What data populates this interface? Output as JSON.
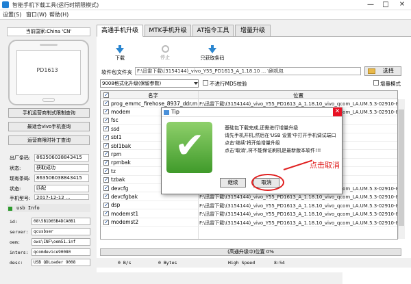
{
  "window": {
    "title": "智能手机下载工具(运行时期限模式)",
    "min": "—",
    "max": "□",
    "close": "✕"
  },
  "menu": [
    "设置(S)",
    "窗口(W)",
    "帮助(H)"
  ],
  "left": {
    "country": "当前国家:China 'CN'",
    "phone_model": "PD1613",
    "buttons": [
      "手机运营商制式限制查询",
      "最适合vivo手机查询",
      "运营商限时补丁查询"
    ],
    "info": [
      {
        "label": "出厂条码:",
        "value": "863506038843415"
      },
      {
        "label": "状态:",
        "value": "获取成功"
      },
      {
        "label": "现有条码:",
        "value": "863506038843415"
      },
      {
        "label": "状态:",
        "value": "匹配"
      },
      {
        "label": "手机型号:",
        "value": "2017-12-12 ..."
      }
    ],
    "usb_title": "usb Info",
    "usb": [
      {
        "key": "id:",
        "value": "08\\5B1D65B4DCA0B1"
      },
      {
        "key": "server:",
        "value": "qcusbser"
      },
      {
        "key": "oem:",
        "value": "ows\\INF\\oem51.inf"
      },
      {
        "key": "inters:",
        "value": "qcomdevice90080"
      },
      {
        "key": "desc:",
        "value": "USB QDLoader 9008"
      }
    ]
  },
  "tabs": [
    "高通手机升级",
    "MTK手机升级",
    "AT指令工具",
    "增量升级"
  ],
  "toolbar": [
    {
      "label": "下载",
      "icon": "download-icon"
    },
    {
      "label": "停止",
      "icon": "stop-icon"
    },
    {
      "label": "只获取条码",
      "icon": "barcode-icon"
    }
  ],
  "firmware": {
    "label": "软件包文件夹",
    "path": "F:\\迅雷下载\\(3154144)_vivo_Y55_PD1613_A_1.18.10 ... \\刷机包",
    "select": "选择"
  },
  "mode": {
    "selected": "9008格式化升级(保留参数)",
    "no_md5": "不进行MD5校验",
    "incremental": "增量模式"
  },
  "table": {
    "headers": [
      "名字",
      "位置"
    ],
    "rows": [
      {
        "name": "prog_emmc_firehose_8937_ddr.mbn",
        "loc": "F:\\迅雷下载\\(3154144)_vivo_Y55_PD1613_A_1.18.10_vivo_qcom_LA.UM.5.3-02910-89..."
      },
      {
        "name": "modem",
        "loc": "F:\\迅雷下载\\(3154144)_vivo_Y55_PD1613_A_1.18.10_vivo_qcom_LA.UM.5.3-02910-89..."
      },
      {
        "name": "fsc",
        "loc": ""
      },
      {
        "name": "ssd",
        "loc": ""
      },
      {
        "name": "sbl1",
        "loc": "...vivo_qcom_LA.UM.5.3-02910-89..."
      },
      {
        "name": "sbl1bak",
        "loc": "...vivo_qcom_LA.UM.5.3-02910-89..."
      },
      {
        "name": "rpm",
        "loc": "...vivo_qcom_LA.UM.5.3-02910-89..."
      },
      {
        "name": "rpmbak",
        "loc": "...vivo_qcom_LA.UM.5.3-02910-89..."
      },
      {
        "name": "tz",
        "loc": "...vivo_qcom_LA.UM.5.3-02910-89..."
      },
      {
        "name": "tzbak",
        "loc": ""
      },
      {
        "name": "devcfg",
        "loc": "F:\\迅雷下载\\(3154144)_vivo_Y55_PD1613_A_1.18.10_vivo_qcom_LA.UM.5.3-02910-89..."
      },
      {
        "name": "devcfgbak",
        "loc": "F:\\迅雷下载\\(3154144)_vivo_Y55_PD1613_A_1.18.10_vivo_qcom_LA.UM.5.3-02910-89..."
      },
      {
        "name": "dsp",
        "loc": "F:\\迅雷下载\\(3154144)_vivo_Y55_PD1613_A_1.18.10_vivo_qcom_LA.UM.5.3-02910-89..."
      },
      {
        "name": "modemst1",
        "loc": "F:\\迅雷下载\\(3154144)_vivo_Y55_PD1613_A_1.18.10_vivo_qcom_LA.UM.5.3-02910-89..."
      },
      {
        "name": "modemst2",
        "loc": "F:\\迅雷下载\\(3154144)_vivo_Y55_PD1613_A_1.18.10_vivo_qcom_LA.UM.5.3-02910-89..."
      }
    ]
  },
  "progress": "(高通升级中)位置 0%",
  "status": [
    "0 B/s",
    "0 Bytes",
    "High Speed",
    "8:54"
  ],
  "dialog": {
    "title": "Tip",
    "close": "✕",
    "lines": [
      "基础包下载完成,还需进行增量升级",
      "请先手机开机,然后在'USB 设置'中打开手机调试端口",
      "点击'继续'将开始增量升级",
      "点击'取消',将不能保证刷机是最新版本软件!!!"
    ],
    "continue": "继续",
    "cancel": "取消"
  },
  "annotation": "点击取消",
  "colors": {
    "accent": "#2b86d0",
    "check": "#4ea934",
    "annot": "#e02020"
  }
}
